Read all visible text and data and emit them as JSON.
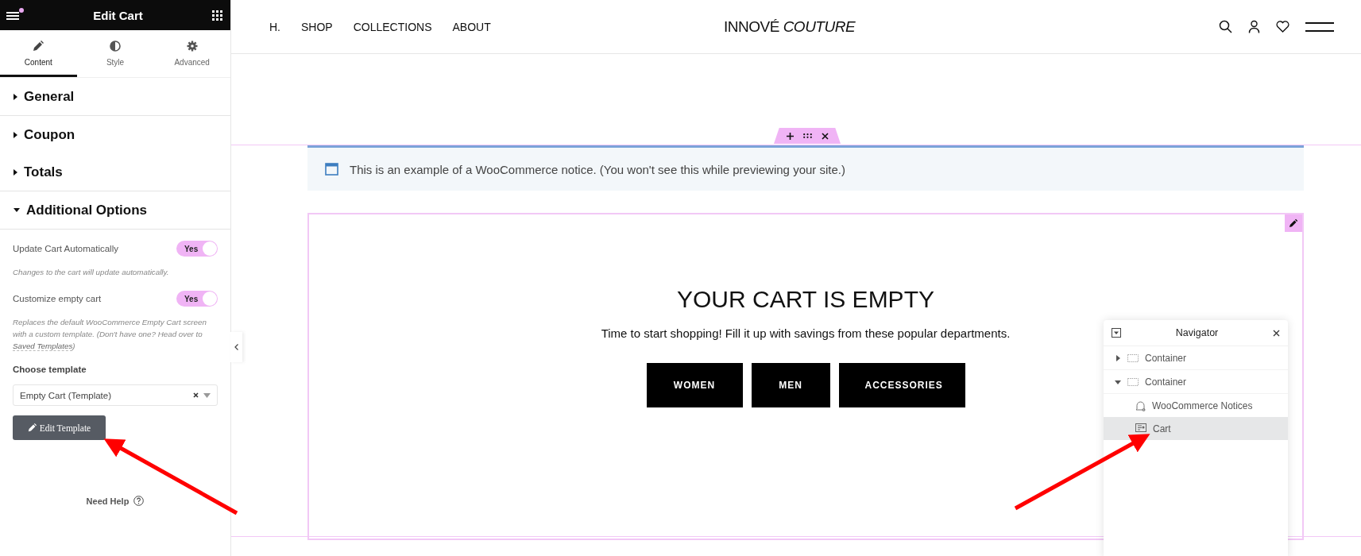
{
  "panel": {
    "title": "Edit Cart",
    "tabs": [
      {
        "label": "Content",
        "selected": true,
        "kind": "pencil"
      },
      {
        "label": "Style",
        "selected": false,
        "kind": "contrast"
      },
      {
        "label": "Advanced",
        "selected": false,
        "kind": "gear"
      }
    ],
    "sections": [
      {
        "label": "General",
        "expanded": false
      },
      {
        "label": "Coupon",
        "expanded": false
      },
      {
        "label": "Totals",
        "expanded": false
      },
      {
        "label": "Additional Options",
        "expanded": true
      }
    ],
    "toggles": [
      {
        "label": "Update Cart Automatically",
        "on": true,
        "value": "Yes",
        "help": "Changes to the cart will update automatically."
      },
      {
        "label": "Customize empty cart",
        "on": true,
        "value": "Yes",
        "help": "Replaces the default WooCommerce Empty Cart screen with a custom template. (Don't have one? Head over to ",
        "link": "Saved Templates",
        "help_end": ")"
      }
    ],
    "template_label": "Choose template",
    "template_value": "Empty Cart (Template)",
    "edit_button": "Edit Template",
    "need_help": "Need Help"
  },
  "site_nav": {
    "links": [
      "H.",
      "SHOP",
      "COLLECTIONS",
      "ABOUT"
    ],
    "logo": "INNOVÉ *COUTURE*"
  },
  "notice": "This is an example of a WooCommerce notice. (You won't see this while previewing your site.)",
  "cart": {
    "heading": "YOUR CART IS EMPTY",
    "text": "Time to start shopping! Fill it up with savings from these popular departments.",
    "buttons": [
      "WOMEN",
      "MEN",
      "ACCESSORIES"
    ]
  },
  "navigator": {
    "title": "Navigator",
    "items": [
      {
        "label": "Container",
        "kind": "container",
        "expanded": false,
        "selected": false
      },
      {
        "label": "Container",
        "kind": "container",
        "expanded": true,
        "selected": false,
        "children": [
          {
            "label": "WooCommerce Notices",
            "kind": "notices",
            "selected": false
          },
          {
            "label": "Cart",
            "kind": "cart",
            "selected": true
          }
        ]
      }
    ]
  }
}
